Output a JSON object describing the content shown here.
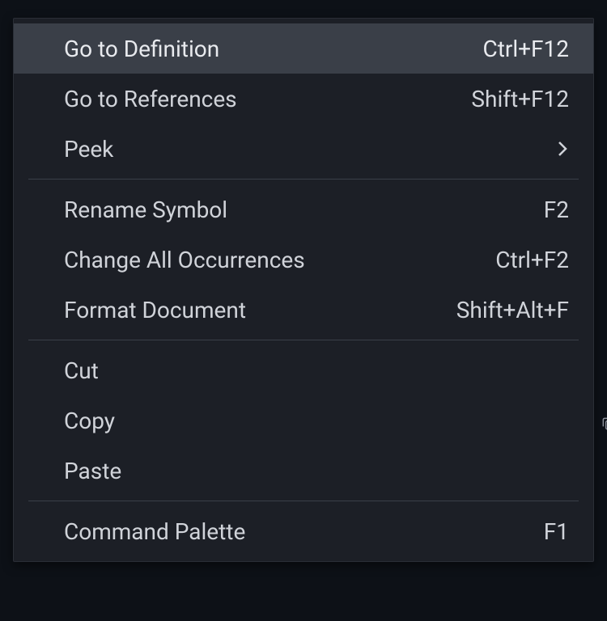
{
  "menu": {
    "groups": [
      [
        {
          "id": "go-to-definition",
          "label": "Go to Definition",
          "shortcut": "Ctrl+F12",
          "highlighted": true
        },
        {
          "id": "go-to-references",
          "label": "Go to References",
          "shortcut": "Shift+F12"
        },
        {
          "id": "peek",
          "label": "Peek",
          "submenu": true
        }
      ],
      [
        {
          "id": "rename-symbol",
          "label": "Rename Symbol",
          "shortcut": "F2"
        },
        {
          "id": "change-all-occurrences",
          "label": "Change All Occurrences",
          "shortcut": "Ctrl+F2"
        },
        {
          "id": "format-document",
          "label": "Format Document",
          "shortcut": "Shift+Alt+F"
        }
      ],
      [
        {
          "id": "cut",
          "label": "Cut"
        },
        {
          "id": "copy",
          "label": "Copy"
        },
        {
          "id": "paste",
          "label": "Paste"
        }
      ],
      [
        {
          "id": "command-palette",
          "label": "Command Palette",
          "shortcut": "F1"
        }
      ]
    ]
  }
}
